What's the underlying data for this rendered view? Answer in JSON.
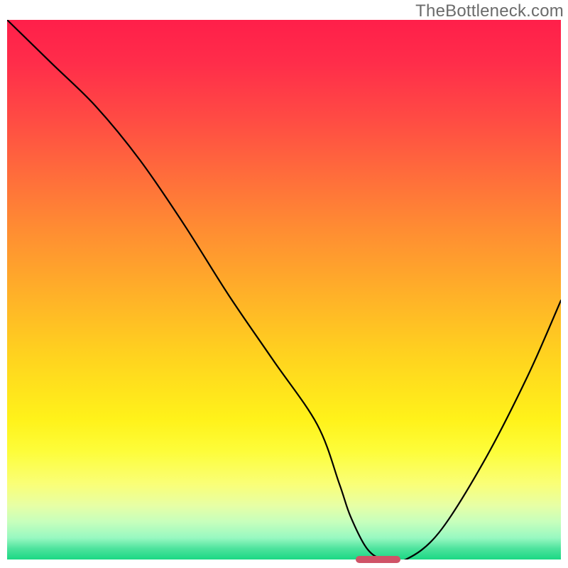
{
  "watermark": "TheBottleneck.com",
  "chart_data": {
    "type": "line",
    "title": "",
    "xlabel": "",
    "ylabel": "",
    "xlim": [
      0,
      100
    ],
    "ylim": [
      0,
      100
    ],
    "grid": false,
    "x": [
      0,
      8,
      16,
      24,
      32,
      40,
      48,
      56,
      60,
      62,
      65,
      68,
      72,
      78,
      86,
      94,
      100
    ],
    "values": [
      100,
      92,
      84,
      74,
      62,
      49,
      37,
      25,
      14,
      8,
      2,
      0,
      0,
      5,
      18,
      34,
      48
    ],
    "marker": {
      "x_start": 63,
      "x_end": 71,
      "y": 0
    }
  },
  "colors": {
    "curve": "#000000",
    "marker": "#cf5367",
    "gradient_top": "#ff1f4a",
    "gradient_bottom": "#1bd884",
    "watermark": "#6b6b6b"
  }
}
